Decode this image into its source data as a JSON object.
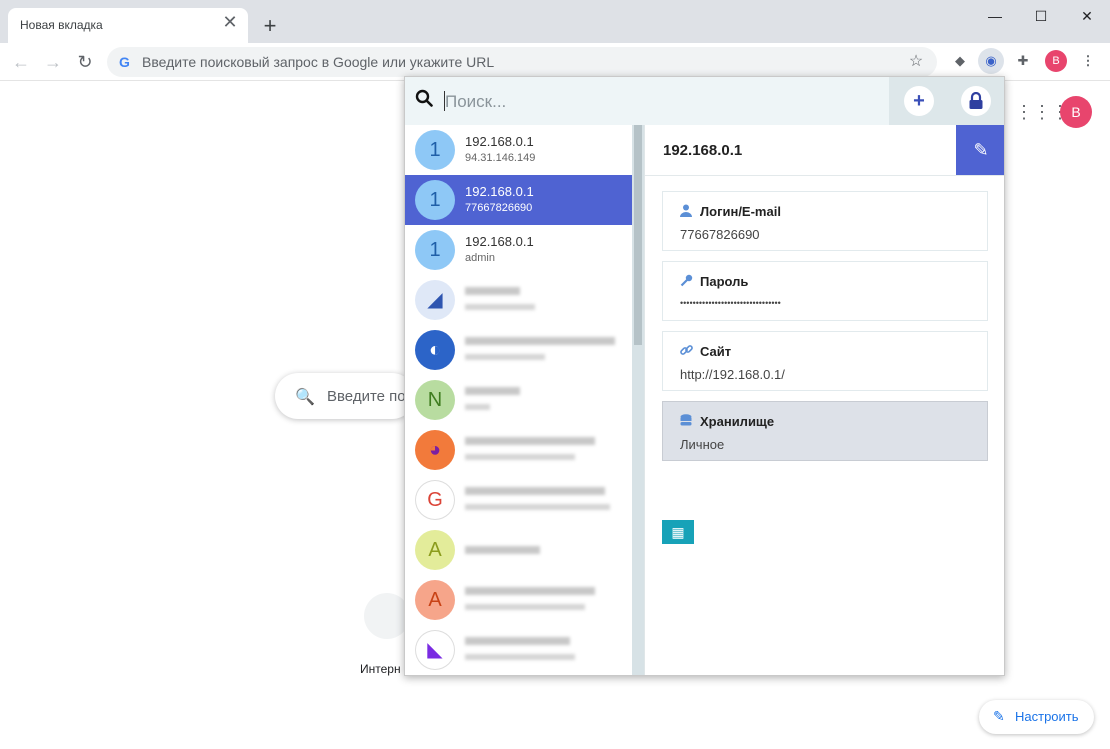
{
  "browser": {
    "tab_title": "Новая вкладка",
    "tab_close": "✕",
    "new_tab": "+",
    "win_min": "—",
    "win_max": "☐",
    "win_close": "✕",
    "back": "←",
    "forward": "→",
    "reload": "↻",
    "g_letter": "G",
    "omnibox_placeholder": "Введите поисковый запрос в Google или укажите URL",
    "star": "☆",
    "ext_ublock": "◆",
    "ext_bitwarden": "◉",
    "ext_puzzle": "✚",
    "profile_letter": "B",
    "menu": "⋮"
  },
  "google": {
    "search_placeholder": "Введите пои",
    "search_icon": "🔍",
    "apps_icon": "⋮⋮⋮",
    "profile_letter": "B",
    "shortcut_label": "Интерн",
    "customize_label": "Настроить",
    "customize_icon": "✎"
  },
  "popup": {
    "search_placeholder": "Поиск...",
    "add_icon": "+",
    "lock_icon": "🔒",
    "items": [
      {
        "icon_letter": "1",
        "title": "192.168.0.1",
        "subtitle": "94.31.146.149",
        "icon_bg": "#8ec8f6",
        "icon_fg": "#1f5fa8"
      },
      {
        "icon_letter": "1",
        "title": "192.168.0.1",
        "subtitle": "77667826690",
        "icon_bg": "#8ec8f6",
        "icon_fg": "#1f5fa8"
      },
      {
        "icon_letter": "1",
        "title": "192.168.0.1",
        "subtitle": "admin",
        "icon_bg": "#8ec8f6",
        "icon_fg": "#1f5fa8"
      },
      {
        "icon_letter": "◢",
        "icon_bg": "#dfe8f7",
        "icon_fg": "#2e55b0"
      },
      {
        "icon_letter": "◐",
        "icon_bg": "#2c64c8",
        "icon_fg": "#ffffff"
      },
      {
        "icon_letter": "N",
        "icon_bg": "#b8dca0",
        "icon_fg": "#3f7d20"
      },
      {
        "icon_letter": "◕",
        "icon_bg": "#f27a3b",
        "icon_fg": "#7b1fa2"
      },
      {
        "icon_letter": "G",
        "icon_bg": "#ffffff",
        "icon_fg": "#db4437"
      },
      {
        "icon_letter": "A",
        "icon_bg": "#e3ec9a",
        "icon_fg": "#8b9c1c"
      },
      {
        "icon_letter": "A",
        "icon_bg": "#f6a58a",
        "icon_fg": "#c84215"
      },
      {
        "icon_letter": "◣",
        "icon_bg": "#ffffff",
        "icon_fg": "#7a2be2"
      }
    ],
    "detail": {
      "title": "192.168.0.1",
      "edit_icon": "✎",
      "login_icon": "👤",
      "login_label": "Логин/E-mail",
      "login_value": "77667826690",
      "password_icon": "🔑",
      "password_label": "Пароль",
      "password_value": "••••••••••••••••••••••••••••••••",
      "site_icon": "🔗",
      "site_label": "Сайт",
      "site_value": "http://192.168.0.1/",
      "vault_icon": "🗄",
      "vault_label": "Хранилище",
      "vault_value": "Личное",
      "qr_icon": "▦"
    }
  },
  "colors": {
    "accent": "#4f63d2",
    "profile": "#e8456d",
    "qr_button": "#17a2b8"
  }
}
